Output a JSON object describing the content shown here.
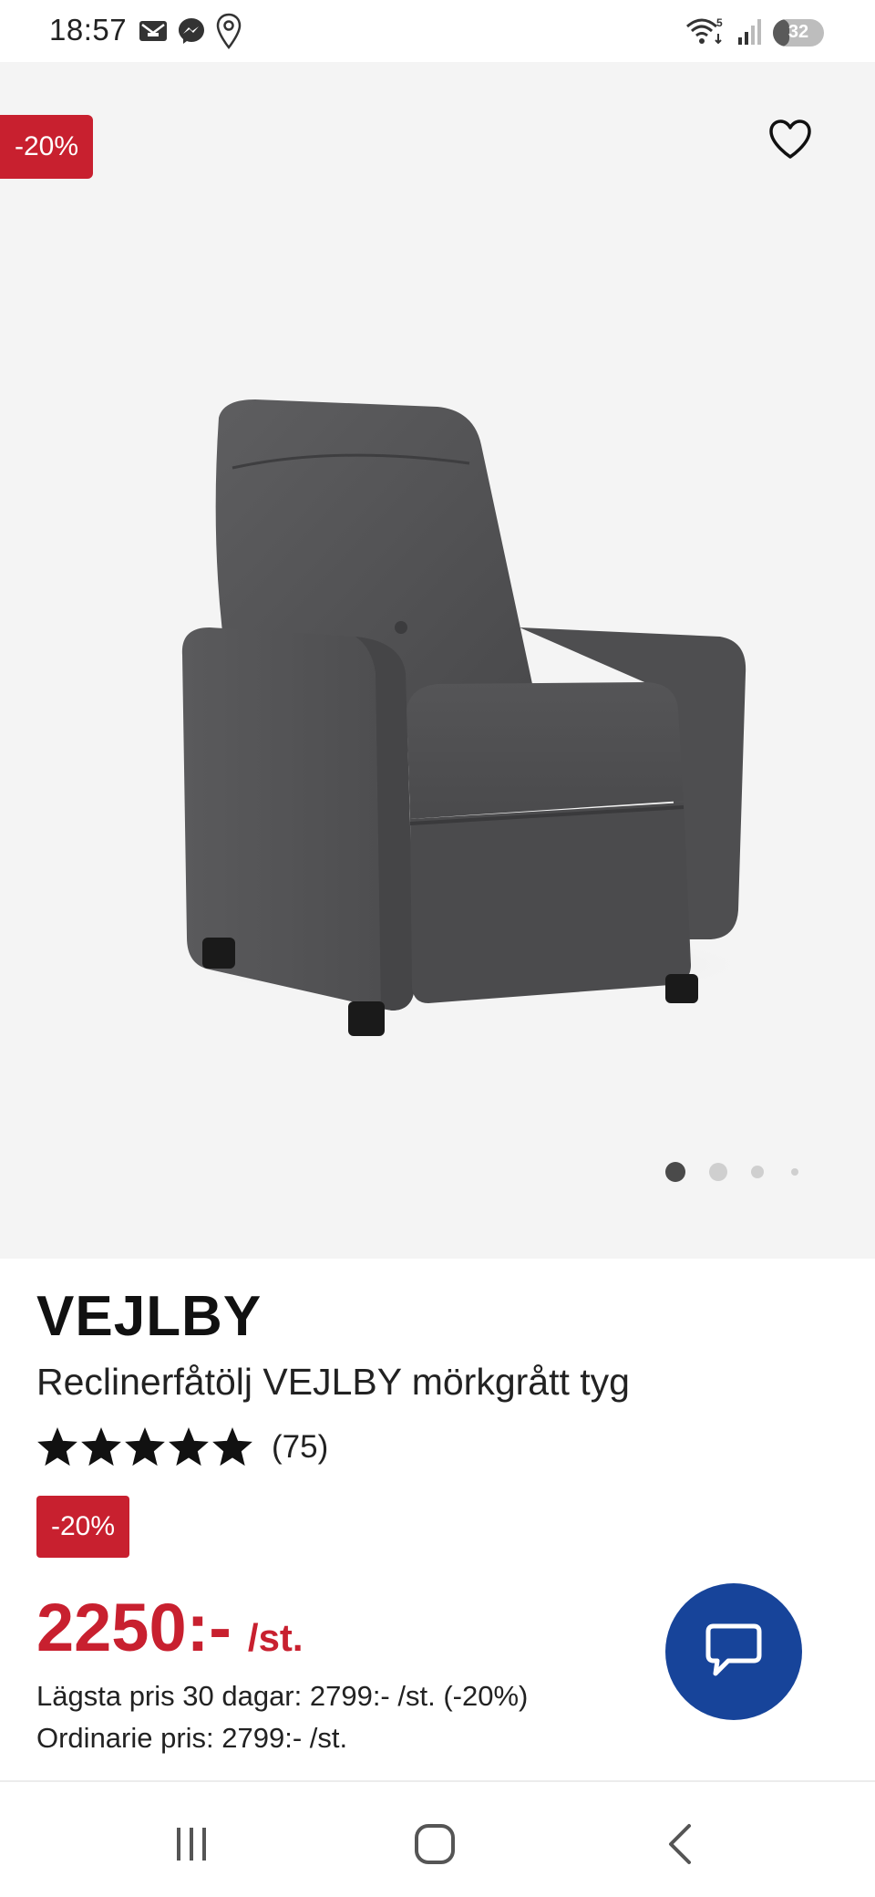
{
  "status_bar": {
    "time": "18:57",
    "left_icons": [
      "mail-icon",
      "messenger-icon",
      "location-pin-icon"
    ],
    "wifi_badge": "5",
    "battery": "32",
    "battery_level_percent": 32
  },
  "product": {
    "discount_badge": "-20%",
    "image_alt": "Reclinerfåtölj VEJLBY mörkgrått tyg",
    "carousel": {
      "total": 4,
      "active_index": 0
    },
    "brand": "VEJLBY",
    "name": "Reclinerfåtölj VEJLBY mörkgrått tyg",
    "rating": {
      "stars": 5,
      "count_label": "(75)"
    },
    "discount_label": "-20%",
    "price": "2250:-",
    "price_unit": "/st.",
    "lowest_price": "Lägsta pris 30 dagar: 2799:- /st. (-20%)",
    "regular_price": "Ordinarie pris: 2799:- /st."
  },
  "colors": {
    "accent_red": "#c8202f",
    "chat_blue": "#17449a",
    "hero_bg": "#f4f4f4"
  },
  "nav": {
    "icons": [
      "recent-apps-icon",
      "home-icon",
      "back-icon"
    ]
  }
}
